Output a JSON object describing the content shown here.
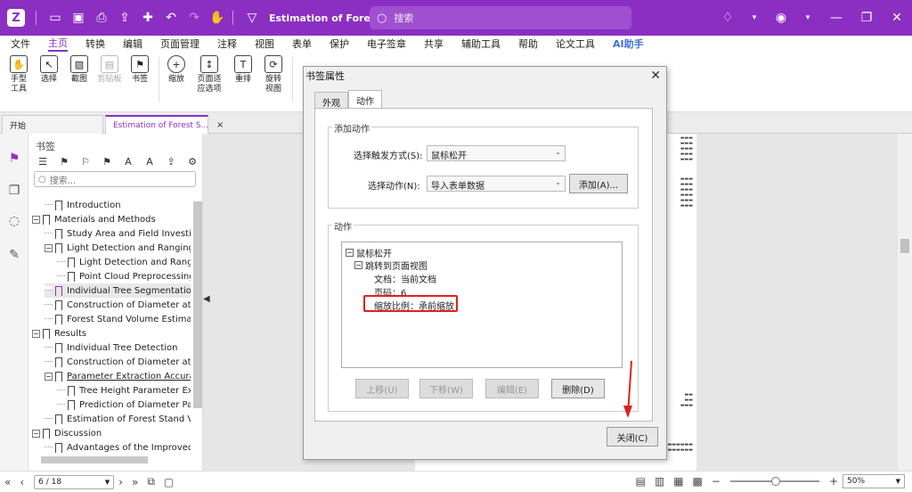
{
  "titlebar": {
    "logo": "Z",
    "doc_title": "Estimation of Forest Stand Vol...",
    "search_placeholder": "搜索"
  },
  "menu": [
    "文件",
    "主页",
    "转换",
    "编辑",
    "页面管理",
    "注释",
    "视图",
    "表单",
    "保护",
    "电子签章",
    "共享",
    "辅助工具",
    "帮助",
    "论文工具",
    "AI助手"
  ],
  "menu_active": "主页",
  "ribbon": {
    "hand": "手型\n工具",
    "select": "选择",
    "screenshot": "截图",
    "clipboard": "剪贴板",
    "bookmark": "书签",
    "zoom": "缩放",
    "fit_page": "页面适\n应选项",
    "reflow": "重排",
    "rotate": "旋转\n视图"
  },
  "tabs": {
    "home": "开始",
    "doc": "Estimation of Forest S...",
    "close": "×"
  },
  "bookmarks": {
    "title": "书签",
    "search_placeholder": "搜索...",
    "items": [
      {
        "label": "Introduction",
        "level": 1,
        "expand": ""
      },
      {
        "label": "Materials and Methods",
        "level": 0,
        "expand": "−"
      },
      {
        "label": "Study Area and Field Investigation",
        "level": 1,
        "expand": ""
      },
      {
        "label": "Light Detection and Ranging (LiDAR)",
        "level": 1,
        "expand": "−"
      },
      {
        "label": "Light Detection and Ranging",
        "level": 2,
        "expand": ""
      },
      {
        "label": "Point Cloud Preprocessing",
        "level": 2,
        "expand": ""
      },
      {
        "label": "Individual Tree Segmentation",
        "level": 1,
        "expand": "",
        "selected": true
      },
      {
        "label": "Construction of Diameter at Breast",
        "level": 1,
        "expand": ""
      },
      {
        "label": "Forest Stand Volume Estimation",
        "level": 1,
        "expand": ""
      },
      {
        "label": "Results",
        "level": 0,
        "expand": "−"
      },
      {
        "label": "Individual Tree Detection",
        "level": 1,
        "expand": ""
      },
      {
        "label": "Construction of Diameter at Breast",
        "level": 1,
        "expand": ""
      },
      {
        "label": "Parameter Extraction Accuracy",
        "level": 1,
        "expand": "−",
        "underline": true
      },
      {
        "label": "Tree Height Parameter Extraction",
        "level": 2,
        "expand": ""
      },
      {
        "label": "Prediction of Diameter Parameter",
        "level": 2,
        "expand": ""
      },
      {
        "label": "Estimation of Forest Stand Volume",
        "level": 1,
        "expand": ""
      },
      {
        "label": "Discussion",
        "level": 0,
        "expand": "−"
      },
      {
        "label": "Advantages of the Improved Individual",
        "level": 1,
        "expand": ""
      }
    ]
  },
  "dialog": {
    "title": "书签属性",
    "close": "✕",
    "tab_appearance": "外观",
    "tab_action": "动作",
    "add_action_group": "添加动作",
    "trigger_label": "选择触发方式(S):",
    "trigger_value": "鼠标松开",
    "action_label": "选择动作(N):",
    "action_value": "导入表单数据",
    "add_button": "添加(A)...",
    "actions_group": "动作",
    "tree": {
      "root": "鼠标松开",
      "child": "跳转到页面视图",
      "doc": "文档：当前文档",
      "page": "页码：6",
      "zoom": "缩放比例：承前缩放"
    },
    "btn_up": "上移(U)",
    "btn_down": "下移(W)",
    "btn_edit": "编辑(E)",
    "btn_delete": "删除(D)",
    "btn_close": "关闭(C)"
  },
  "status": {
    "page_value": "6 / 18",
    "zoom_value": "50%",
    "zoom_level": 0.5
  },
  "colors": {
    "brand": "#8b2fc2",
    "highlight": "#e02020"
  }
}
